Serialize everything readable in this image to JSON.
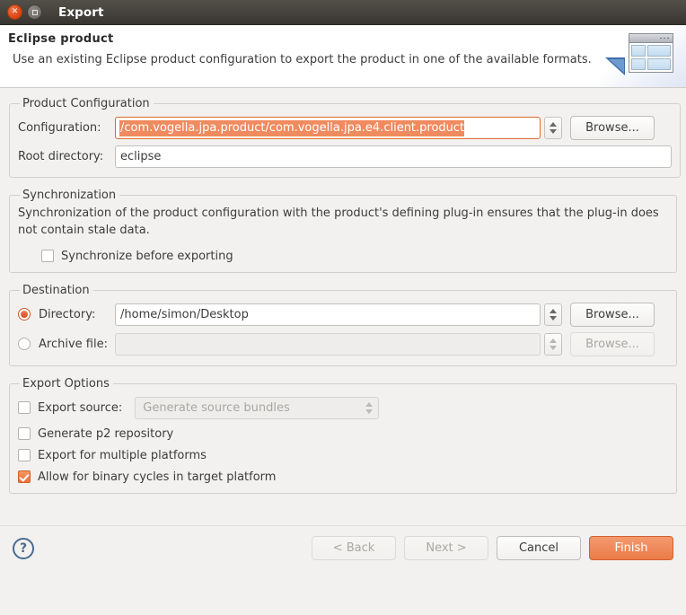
{
  "window": {
    "title": "Export",
    "close_icon": "close-icon",
    "maximize_icon": "maximize-icon"
  },
  "header": {
    "title": "Eclipse product",
    "description": "Use an existing Eclipse product configuration to export the product in one of the available formats.",
    "banner_icon": "product-window-banner-icon"
  },
  "product_configuration": {
    "legend": "Product Configuration",
    "configuration_label": "Configuration:",
    "configuration_value": "/com.vogella.jpa.product/com.vogella.jpa.e4.client.product",
    "configuration_browse": "Browse...",
    "root_directory_label": "Root directory:",
    "root_directory_value": "eclipse"
  },
  "synchronization": {
    "legend": "Synchronization",
    "description": "Synchronization of the product configuration with the product's defining plug-in ensures that the plug-in does not contain stale data.",
    "checkbox_label": "Synchronize before exporting",
    "checkbox_checked": false
  },
  "destination": {
    "legend": "Destination",
    "directory_label": "Directory:",
    "directory_selected": true,
    "directory_value": "/home/simon/Desktop",
    "directory_browse": "Browse...",
    "archive_label": "Archive file:",
    "archive_selected": false,
    "archive_value": "",
    "archive_browse": "Browse..."
  },
  "export_options": {
    "legend": "Export Options",
    "export_source_label": "Export source:",
    "export_source_checked": false,
    "export_source_combo_value": "Generate source bundles",
    "generate_p2_label": "Generate p2 repository",
    "generate_p2_checked": false,
    "multiple_platforms_label": "Export for multiple platforms",
    "multiple_platforms_checked": false,
    "binary_cycles_label": "Allow for binary cycles in target platform",
    "binary_cycles_checked": true
  },
  "footer": {
    "help_icon": "help-icon",
    "back_label": "< Back",
    "next_label": "Next >",
    "cancel_label": "Cancel",
    "finish_label": "Finish"
  },
  "colors": {
    "accent": "#dd4814",
    "selection": "#f08a5f",
    "primary_button": "#ec7b49",
    "titlebar": "#46433d"
  }
}
